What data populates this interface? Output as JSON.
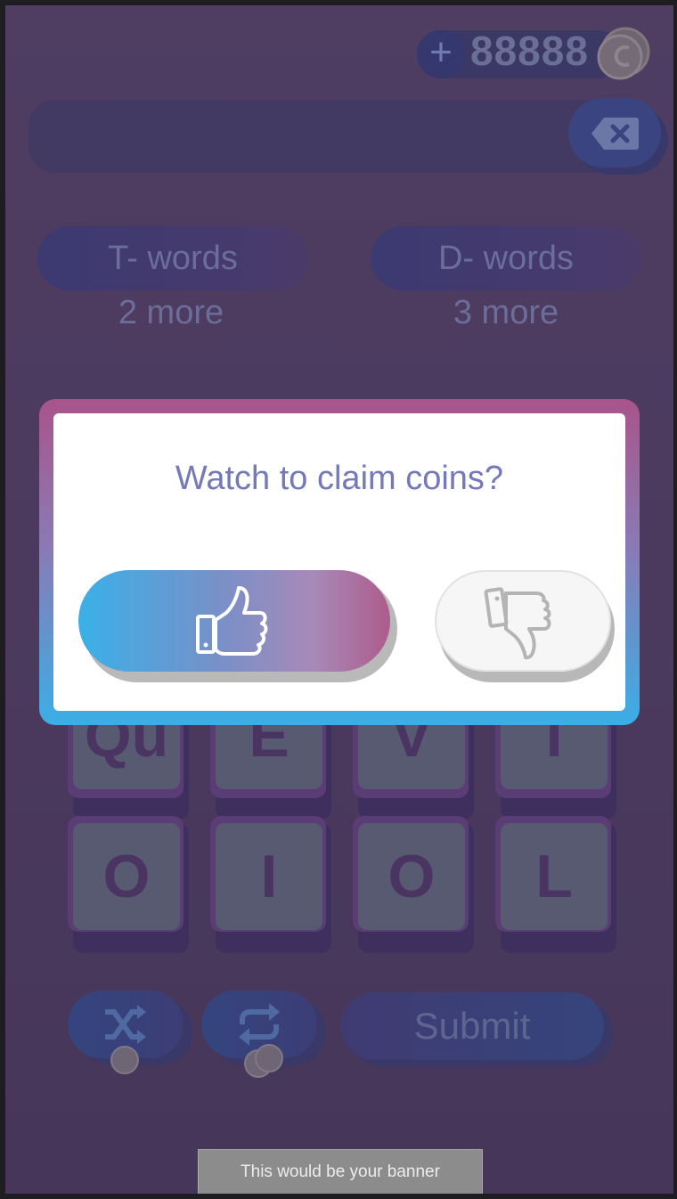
{
  "header": {
    "add_coins_label": "+",
    "coin_count": "88888",
    "coin_icon": "coin-stack-icon"
  },
  "word_entry": {
    "value": "",
    "delete_icon": "backspace-icon"
  },
  "targets": [
    {
      "label": "T- words",
      "remaining": "2 more"
    },
    {
      "label": "D- words",
      "remaining": "3 more"
    }
  ],
  "tiles": {
    "row1": [
      "Qu",
      "E",
      "V",
      "T"
    ],
    "row2": [
      "O",
      "I",
      "O",
      "L"
    ]
  },
  "actions": {
    "shuffle_icon": "shuffle-icon",
    "refresh_icon": "refresh-icon",
    "submit_label": "Submit"
  },
  "banner": {
    "text": "This would be your banner"
  },
  "modal": {
    "title": "Watch to claim coins?",
    "confirm_icon": "thumbs-up-icon",
    "decline_icon": "thumbs-down-icon"
  },
  "colors": {
    "background": "#4b3a5e",
    "modal_gradient_top": "#a8548a",
    "modal_gradient_bottom": "#3baee6",
    "modal_title": "#7479b9",
    "confirm_gradient_start": "#3ab0e8",
    "confirm_gradient_end": "#ad5c8c"
  }
}
